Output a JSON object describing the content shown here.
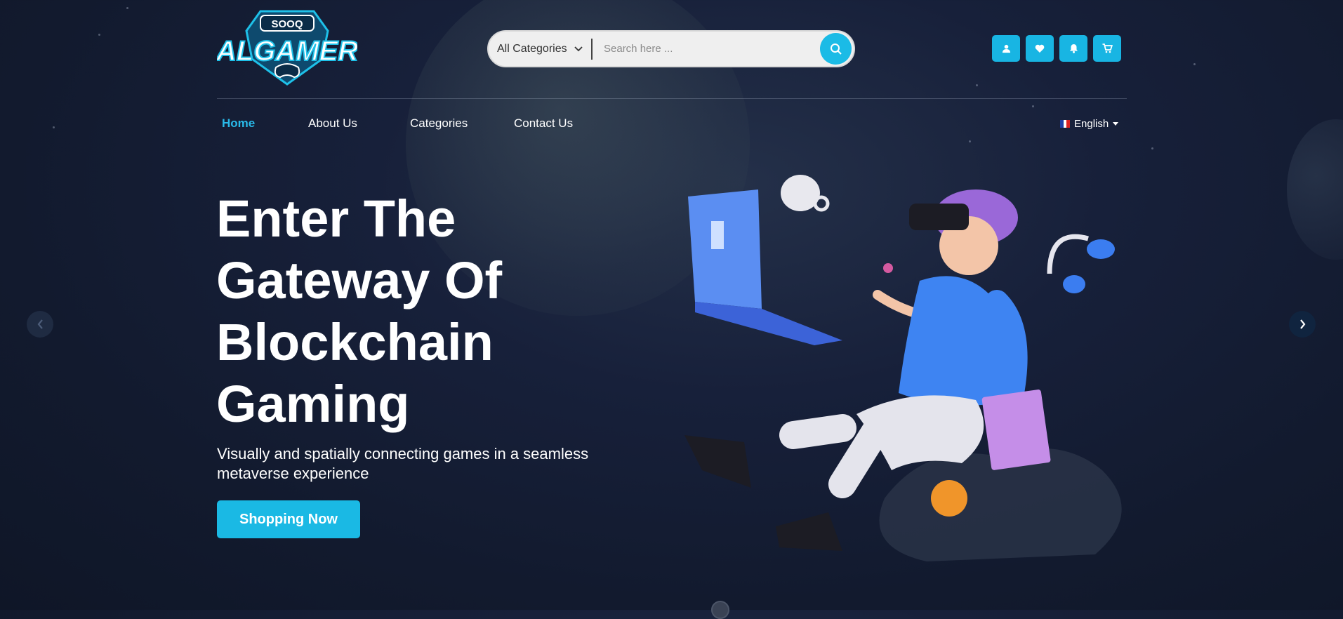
{
  "brand": {
    "logo_top": "SOOQ",
    "logo_main": "ALGAMER"
  },
  "search": {
    "category_label": "All Categories",
    "placeholder": "Search here ..."
  },
  "header_icons": [
    "user-icon",
    "heart-icon",
    "bell-icon",
    "cart-icon"
  ],
  "nav": {
    "items": [
      "Home",
      "About Us",
      "Categories",
      "Contact Us"
    ],
    "active": "Home"
  },
  "language": {
    "label": "English"
  },
  "hero": {
    "title_lines": [
      "Enter The",
      "Gateway Of",
      "Blockchain",
      "Gaming"
    ],
    "subtitle": "Visually and spatially connecting games in a seamless metaverse experience",
    "cta_label": "Shopping Now"
  },
  "colors": {
    "accent": "#1ab9e4",
    "active_nav": "#29b9e8",
    "background": "#17203a"
  }
}
